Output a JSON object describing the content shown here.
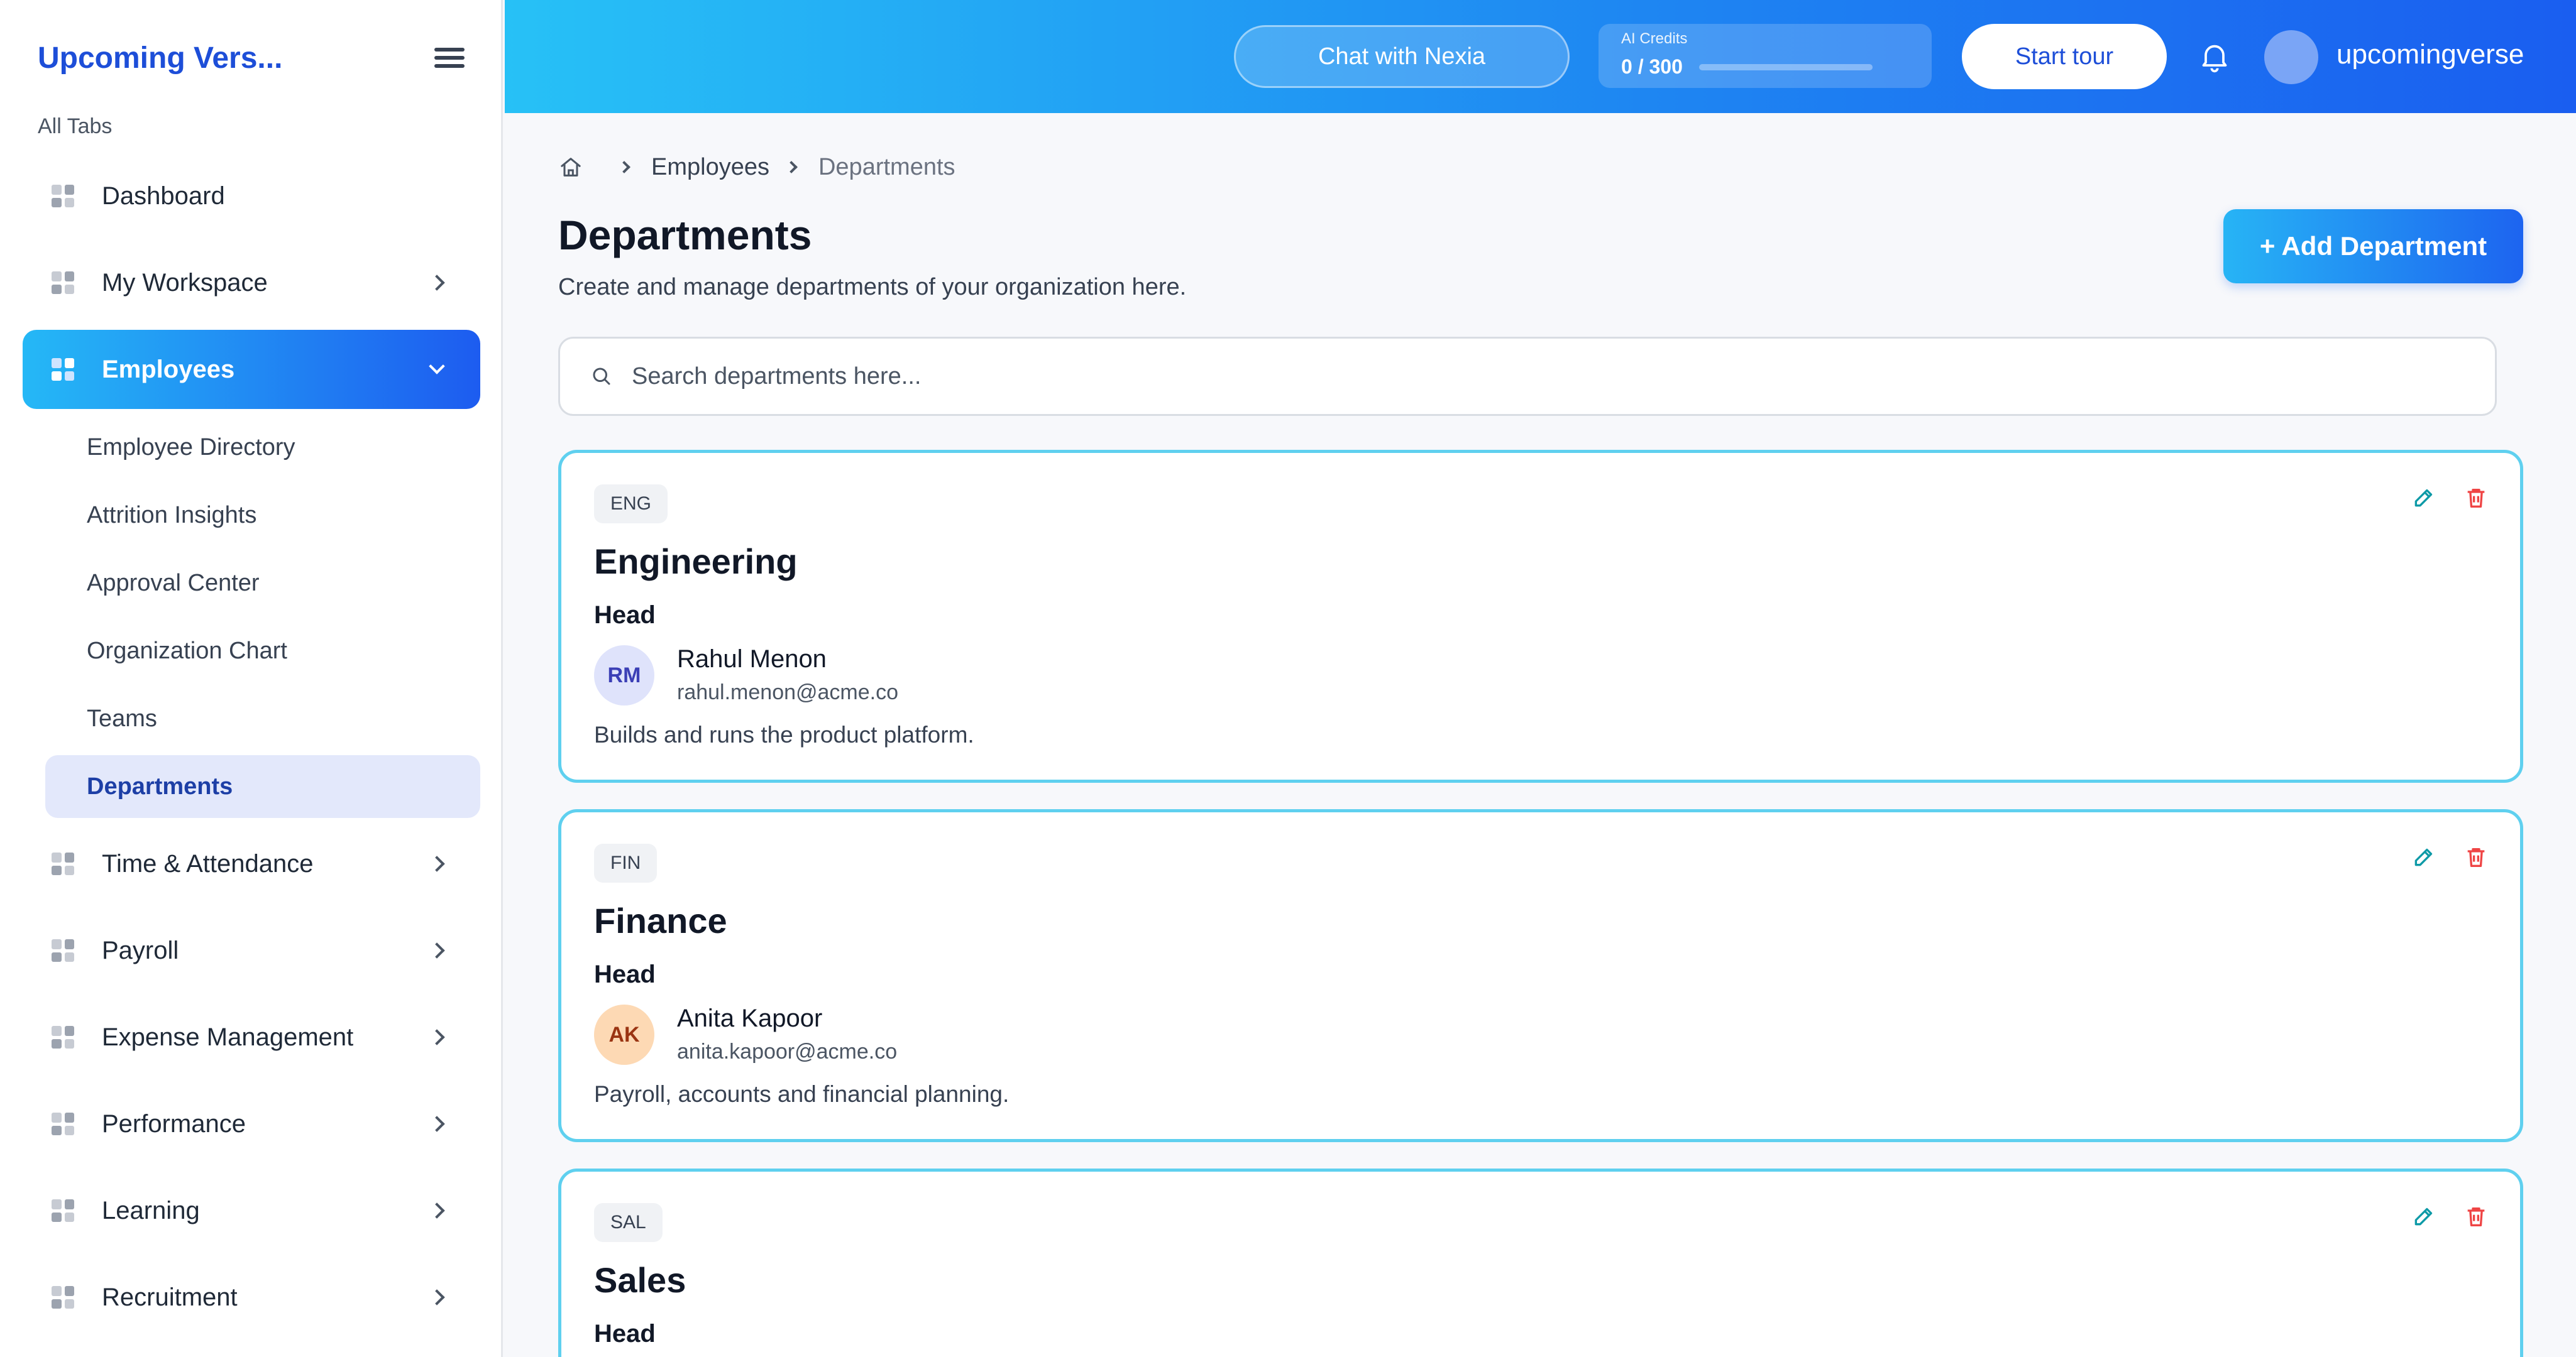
{
  "sidebar": {
    "brand": "Upcoming Vers...",
    "section_label": "All Tabs",
    "items": [
      {
        "label": "Dashboard"
      },
      {
        "label": "My Workspace"
      },
      {
        "label": "Employees"
      },
      {
        "label": "Time & Attendance"
      },
      {
        "label": "Payroll"
      },
      {
        "label": "Expense Management"
      },
      {
        "label": "Performance"
      },
      {
        "label": "Learning"
      },
      {
        "label": "Recruitment"
      }
    ],
    "sub_items": [
      {
        "label": "Employee Directory"
      },
      {
        "label": "Attrition Insights"
      },
      {
        "label": "Approval Center"
      },
      {
        "label": "Organization Chart"
      },
      {
        "label": "Teams"
      },
      {
        "label": "Departments"
      }
    ]
  },
  "topbar": {
    "chat_label": "Chat with Nexia",
    "credits_label": "AI Credits",
    "credits_value": "0 / 300",
    "credits_used_fraction": 0.0,
    "tour_label": "Start tour",
    "username": "upcomingverse"
  },
  "main": {
    "breadcrumb": {
      "parent": "Employees",
      "current": "Departments"
    },
    "title": "Departments",
    "subtitle": "Create and manage departments of your organization here.",
    "add_button": "+ Add Department",
    "search_placeholder": "Search departments here...",
    "departments": [
      {
        "code": "ENG",
        "name": "Engineering",
        "head_label": "Head",
        "head_initials": "RM",
        "head_name": "Rahul Menon",
        "head_email": "rahul.menon@acme.co",
        "description": "Builds and runs the product platform."
      },
      {
        "code": "FIN",
        "name": "Finance",
        "head_label": "Head",
        "head_initials": "AK",
        "head_name": "Anita Kapoor",
        "head_email": "anita.kapoor@acme.co",
        "description": "Payroll, accounts and financial planning."
      },
      {
        "code": "SAL",
        "name": "Sales",
        "head_label": "Head"
      }
    ]
  },
  "colors": {
    "accent": "#1d4ed8",
    "card_border": "#5fd0ef",
    "edit_icon": "#0e9aa7",
    "delete_icon": "#ef4444",
    "avatar_rm_bg": "#dfe3fb",
    "avatar_rm_fg": "#3b3fb6",
    "avatar_ak_bg": "#fdd9b4",
    "avatar_ak_fg": "#9a3412"
  },
  "icons": [
    "menu-icon",
    "grid-icon",
    "chevron-right-icon",
    "chevron-down-icon",
    "bell-icon",
    "home-icon",
    "search-icon",
    "pencil-icon",
    "trash-icon"
  ]
}
